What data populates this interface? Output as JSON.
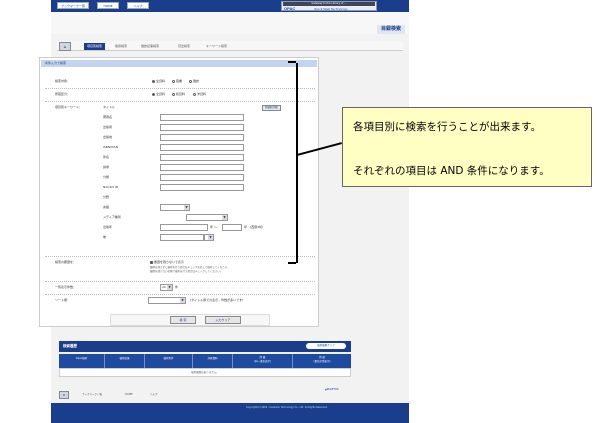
{
  "nav": {
    "booklist": "ブックマーク一覧",
    "home": "HOME",
    "help": "ヘルプ"
  },
  "logo": {
    "top": "Gateway to the Library of ...",
    "name": "OPAC",
    "sub": "Quick Web Technology"
  },
  "page_title": "目録検索",
  "tabs": [
    "項目別検索",
    "簡易検索",
    "雑誌記事検索",
    "貸出検索",
    "キーワード検索"
  ],
  "panel": {
    "header": "条件入力で検索",
    "rows": [
      {
        "label": "検索対象：",
        "options": [
          "全資料",
          "図書",
          "雑誌"
        ]
      },
      {
        "label": "所蔵区分：",
        "options": [
          "全資料",
          "和資料",
          "洋資料"
        ]
      },
      {
        "label": "項目別キーワード："
      }
    ],
    "fields": [
      "タイトル",
      "著者名",
      "出版者",
      "出版地",
      "ISBN/ISSN",
      "件名",
      "請求",
      "分類",
      "NACSIS ID",
      "分野",
      "言語",
      "メディア種別",
      "出版年",
      "巻"
    ],
    "search_button": "所蔵館詳細",
    "year_sep": "年 ～",
    "year_end": "年",
    "year_note": "(西暦4桁)",
    "remove_label": "検索の履歴を：",
    "remove_check": "履歴を残さないで表示",
    "notes": [
      "履歴を残さずに検索を行う場合はチェックを外して検索してください。",
      "履歴を残さない状態で検索を行う場合はチェックしてください。"
    ],
    "sort_label": "一覧表示件数：",
    "sort_value": "20",
    "sort_unit": "件",
    "order_label": "ソート順：",
    "order_note": "(タイトル順での表示…件数が多いです)"
  },
  "buttons": {
    "search": "検 索",
    "clear": "入力クリア"
  },
  "history": {
    "title": "検索履歴",
    "clear": "検索履歴クリア",
    "columns": [
      "Opac検索",
      "検索結果",
      "検索条件",
      "対象資料",
      "所 蔵\n(同一書名表示)",
      "所 蔵\n(書名記事表示)"
    ],
    "empty": "検索履歴はありません。"
  },
  "pagetop": "▲PAGETOP",
  "bottom_links": [
    "ブックマーク一覧",
    "HOME",
    "ヘルプ"
  ],
  "copyright": "Copyright(C) 2009 - Kuaimion Technology Co., Ltd. All Rights Reserved.",
  "callout": {
    "line1": "各項目別に検索を行うことが出来ます。",
    "line2": "それぞれの項目は AND 条件になります。"
  },
  "colors": {
    "navy": "#1a3d8c",
    "callout_bg": "#ffffc4"
  }
}
